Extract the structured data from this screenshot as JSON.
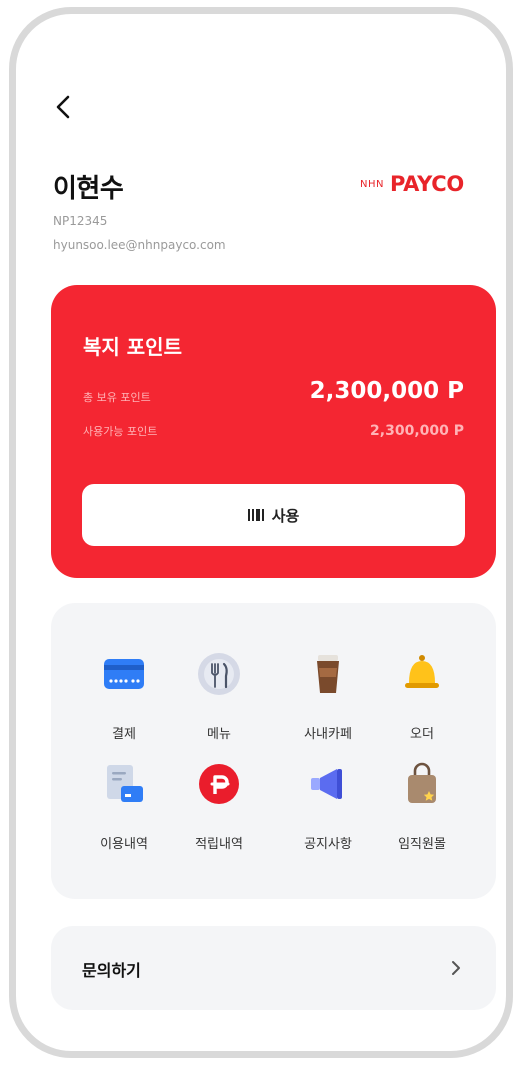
{
  "user": {
    "name": "이현수",
    "employee_id": "NP12345",
    "email": "hyunsoo.lee@nhnpayco.com"
  },
  "brand": {
    "prefix": "NHN",
    "name": "PAYCO",
    "color": "#e8242a"
  },
  "points_card": {
    "title": "복지 포인트",
    "total_label": "총 보유 포인트",
    "total_value": "2,300,000 P",
    "available_label": "사용가능 포인트",
    "available_value": "2,300,000 P",
    "use_button_label": "사용",
    "color": "#f42632"
  },
  "menu": {
    "items": [
      {
        "label": "결제",
        "icon": "credit-card-icon"
      },
      {
        "label": "메뉴",
        "icon": "fork-knife-icon"
      },
      {
        "label": "사내카페",
        "icon": "coffee-cup-icon"
      },
      {
        "label": "오더",
        "icon": "bell-icon"
      },
      {
        "label": "이용내역",
        "icon": "receipt-card-icon"
      },
      {
        "label": "적립내역",
        "icon": "point-p-icon"
      },
      {
        "label": "공지사항",
        "icon": "megaphone-icon"
      },
      {
        "label": "임직원몰",
        "icon": "shopping-bag-icon"
      }
    ]
  },
  "inquiry": {
    "label": "문의하기"
  }
}
